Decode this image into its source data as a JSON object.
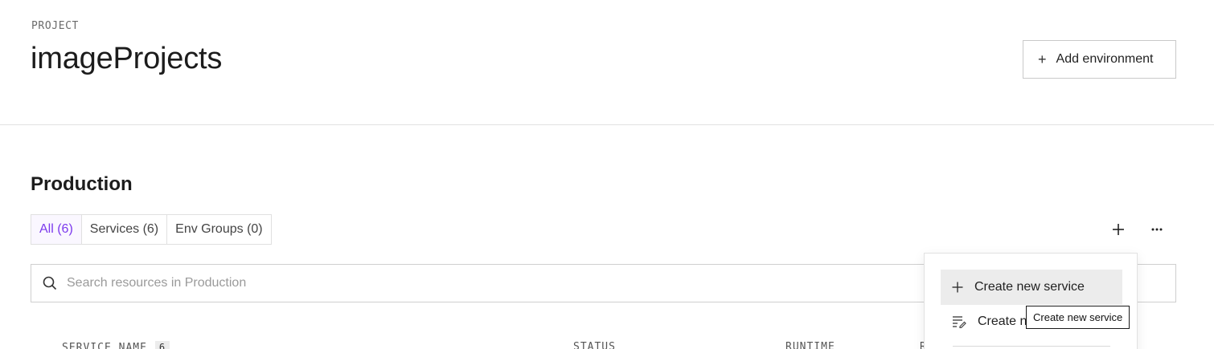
{
  "project": {
    "eyebrow": "PROJECT",
    "title": "imageProjects",
    "add_environment_label": "Add environment"
  },
  "environment": {
    "title": "Production",
    "tabs": [
      {
        "label": "All (6)",
        "active": true
      },
      {
        "label": "Services (6)",
        "active": false
      },
      {
        "label": "Env Groups (0)",
        "active": false
      }
    ],
    "actions": {
      "add_icon": "plus-icon",
      "more_icon": "more-horizontal-icon"
    },
    "search": {
      "placeholder": "Search resources in Production",
      "value": ""
    }
  },
  "table": {
    "columns": {
      "service_name": "SERVICE NAME",
      "service_count": "6",
      "status": "STATUS",
      "runtime": "RUNTIME",
      "region": "R"
    }
  },
  "dropdown_menu": {
    "items": [
      {
        "label": "Create new service",
        "icon": "plus-icon",
        "highlighted": true
      },
      {
        "label": "Create n",
        "icon": "edit-list-icon",
        "highlighted": false
      }
    ]
  },
  "tooltip": {
    "text": "Create new service"
  },
  "colors": {
    "accent": "#7c3aed",
    "border": "#e0e0e0",
    "menu_hover": "#ececec"
  }
}
